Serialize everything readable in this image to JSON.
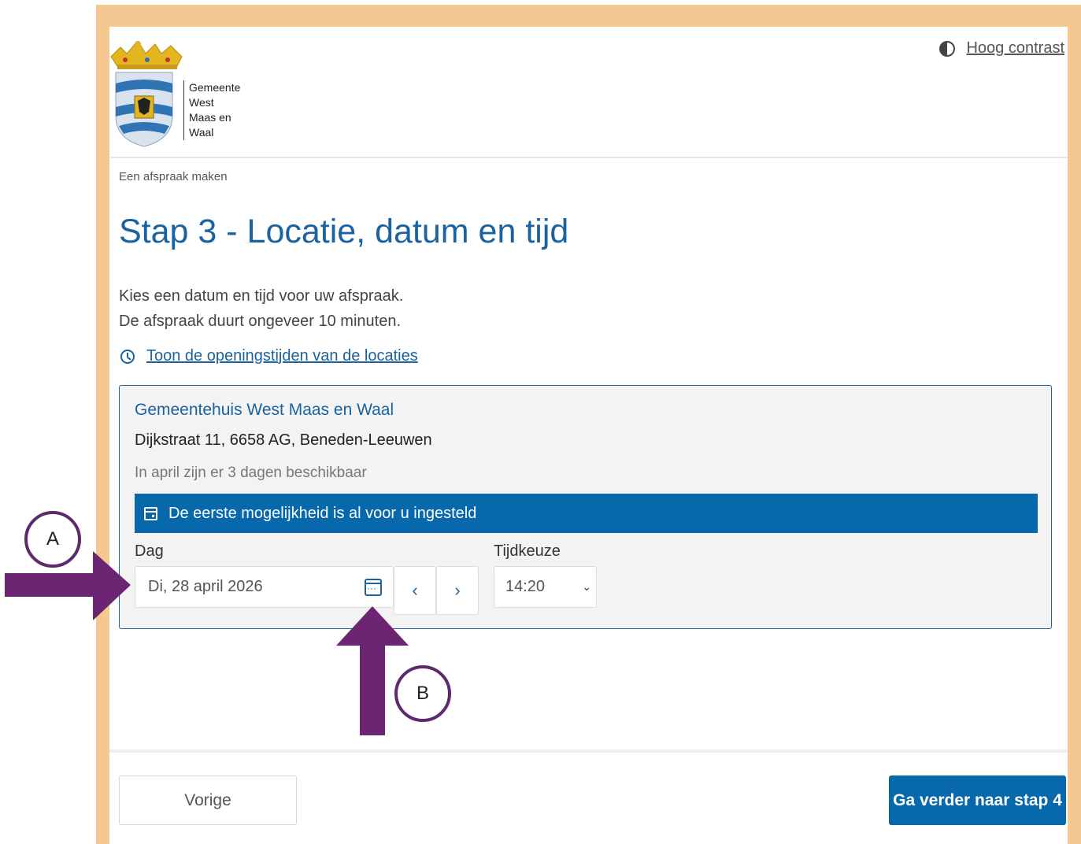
{
  "header": {
    "logo_text": [
      "Gemeente",
      "West",
      "Maas en",
      "Waal"
    ],
    "contrast_label": "Hoog contrast"
  },
  "breadcrumb": "Een afspraak maken",
  "title": "Stap 3 - Locatie, datum en tijd",
  "intro": {
    "line1": "Kies een datum en tijd voor uw afspraak.",
    "line2": "De afspraak duurt ongeveer 10 minuten."
  },
  "hours_link": "Toon de openingstijden van de locaties",
  "location": {
    "name": "Gemeentehuis West Maas en Waal",
    "address": "Dijkstraat 11, 6658 AG, Beneden-Leeuwen",
    "availability": "In april zijn er 3 dagen beschikbaar",
    "banner": "De eerste mogelijkheid is al voor u ingesteld",
    "day_label": "Dag",
    "day_value": "Di, 28 april 2026",
    "prev_day": "‹",
    "next_day": "›",
    "time_label": "Tijdkeuze",
    "time_value": "14:20"
  },
  "footer": {
    "prev_label": "Vorige",
    "next_label": "Ga verder naar stap 4"
  },
  "annotations": {
    "a": "A",
    "b": "B",
    "color": "#6b2572"
  },
  "colors": {
    "frame": "#f6c891",
    "primary": "#0868ac",
    "title": "#1a63a0"
  }
}
